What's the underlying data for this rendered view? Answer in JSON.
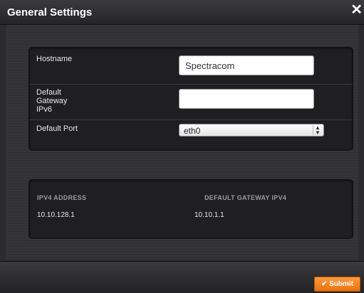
{
  "dialog": {
    "title": "General Settings",
    "close_symbol": "✕"
  },
  "form": {
    "hostname": {
      "label": "Hostname",
      "value": "Spectracom"
    },
    "gateway_ipv6": {
      "label_lines": [
        "Default",
        "Gateway",
        "IPv6"
      ],
      "value": ""
    },
    "default_port": {
      "label": "Default Port",
      "selected": "eth0",
      "arrow_up": "▲",
      "arrow_down": "▼"
    }
  },
  "table": {
    "headers": [
      "IPV4 ADDRESS",
      "DEFAULT GATEWAY IPV4"
    ],
    "rows": [
      [
        "10.10.128.1",
        "10.10.1.1"
      ]
    ]
  },
  "footer": {
    "submit_label": "Submit",
    "submit_icon": "✔"
  },
  "colors": {
    "accent": "#f0832a",
    "dialog_bg": "#2b2b2d",
    "panel_bg": "#1f1f22"
  }
}
